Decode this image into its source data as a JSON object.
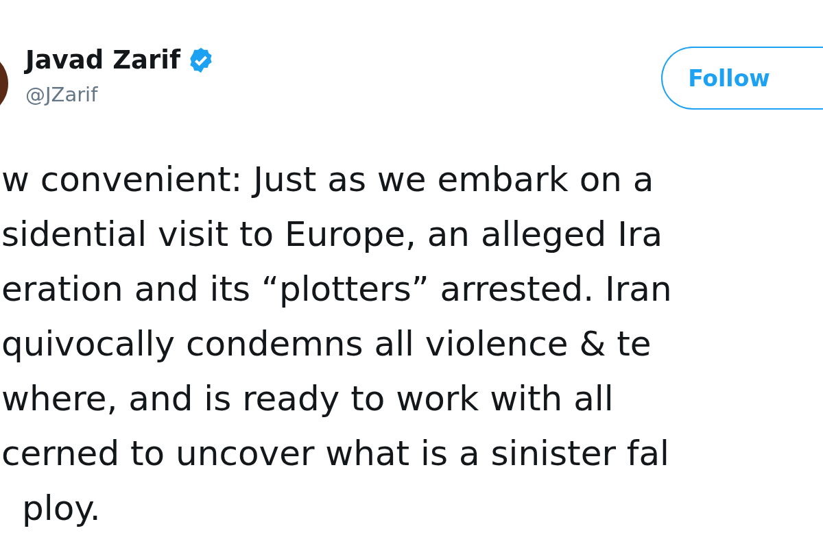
{
  "author": {
    "name": "Javad Zarif",
    "verified": true,
    "handle": "@JZarif"
  },
  "follow_button": {
    "label": "Follow"
  },
  "tweet_lines": [
    "w convenient: Just as we embark on a",
    "sidential visit to Europe, an alleged Ira",
    "eration and its “plotters” arrested. Iran",
    "quivocally condemns all violence & te",
    "where, and is ready to work with all",
    "cerned to uncover what is a sinister fal",
    "ploy."
  ]
}
